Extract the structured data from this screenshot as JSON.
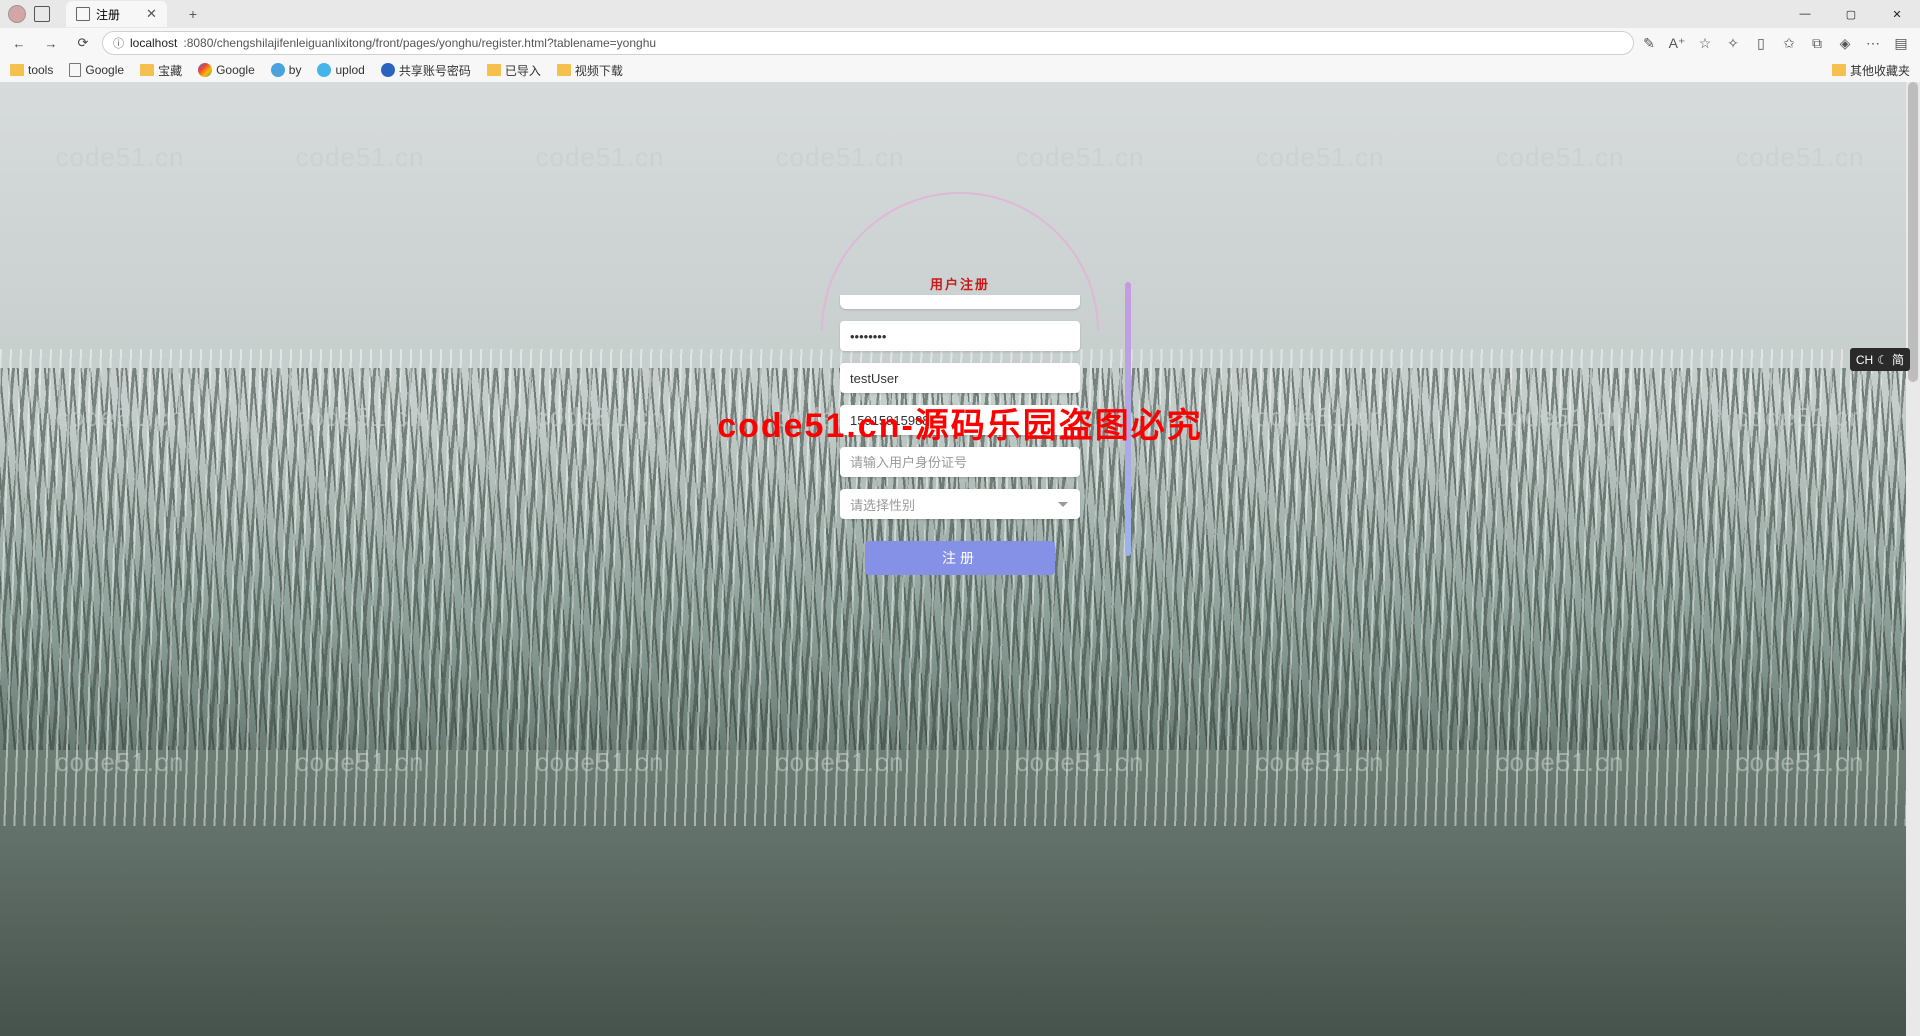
{
  "browser": {
    "tab_title": "注册",
    "url_host": "localhost",
    "url_path": ":8080/chengshilajifenleiguanlixitong/front/pages/yonghu/register.html?tablename=yonghu",
    "window_buttons": {
      "minimize": "—",
      "maximize": "▢",
      "close": "✕"
    },
    "newtab": "+"
  },
  "bookmarks": {
    "items": [
      {
        "label": "tools",
        "type": "folder"
      },
      {
        "label": "Google",
        "type": "page"
      },
      {
        "label": "宝藏",
        "type": "folder"
      },
      {
        "label": "Google",
        "type": "link"
      },
      {
        "label": "by",
        "type": "link"
      },
      {
        "label": "uplod",
        "type": "link"
      },
      {
        "label": "共享账号密码",
        "type": "link"
      },
      {
        "label": "已导入",
        "type": "folder"
      },
      {
        "label": "视频下载",
        "type": "folder"
      }
    ],
    "overflow": "其他收藏夹"
  },
  "watermark": "code51.cn",
  "center_watermark": "code51.cn-源码乐园盗图必究",
  "form": {
    "title": "用户注册",
    "password_value": "••••••••",
    "username_value": "testUser",
    "phone_value": "15915915988",
    "idcard_placeholder": "请输入用户身份证号",
    "gender_placeholder": "请选择性别",
    "register_btn": "注册"
  },
  "ime": {
    "lang": "CH",
    "mode": "简"
  }
}
